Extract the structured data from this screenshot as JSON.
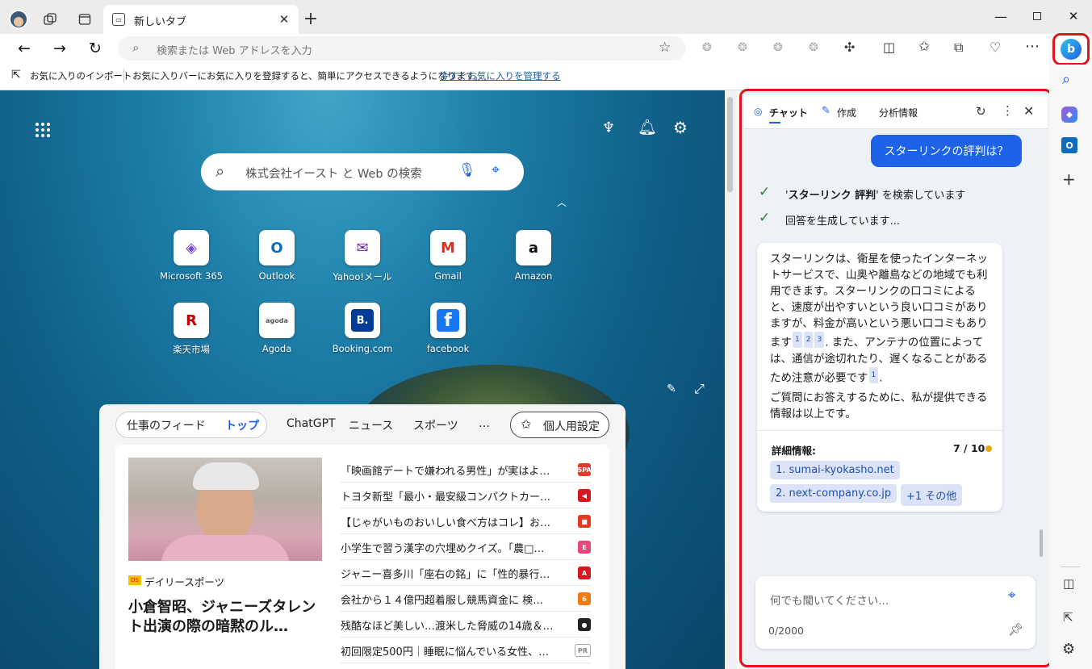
{
  "tab": {
    "title": "新しいタブ"
  },
  "address": {
    "placeholder": "検索または Web アドレスを入力"
  },
  "favbar": {
    "import_label": "お気に入りのインポート",
    "message": "お気に入りバーにお気に入りを登録すると、簡単にアクセスできるようになります。",
    "manage_link": "今すぐお気に入りを管理する"
  },
  "page": {
    "search_placeholder": "株式会社イースト と Web の検索",
    "tiles": [
      {
        "label": "Microsoft 365",
        "icon": "microsoft365-icon"
      },
      {
        "label": "Outlook",
        "icon": "outlook-icon"
      },
      {
        "label": "Yahoo!メール",
        "icon": "yahoo-mail-icon"
      },
      {
        "label": "Gmail",
        "icon": "gmail-icon"
      },
      {
        "label": "Amazon",
        "icon": "amazon-icon"
      },
      {
        "label": "楽天市場",
        "icon": "rakuten-icon"
      },
      {
        "label": "Agoda",
        "icon": "agoda-icon"
      },
      {
        "label": "Booking.com",
        "icon": "booking-icon"
      },
      {
        "label": "facebook",
        "icon": "facebook-icon"
      }
    ]
  },
  "feed": {
    "tabs": [
      "仕事のフィード",
      "トップ",
      "ChatGPT",
      "ニュース",
      "スポーツ",
      "…"
    ],
    "personalize": "個人用設定",
    "hero_source": "デイリースポーツ",
    "hero_title": "小倉智昭、ジャニーズタレント出演の際の暗黙のル…",
    "items": [
      {
        "text": "「映画館デートで嫌われる男性」が実はよ…",
        "src": "SPA",
        "color": "#e23b2c"
      },
      {
        "text": "トヨタ新型「最小・最安級コンパクトカー…",
        "src": "◀",
        "color": "#d7191f"
      },
      {
        "text": "【じゃがいものおいしい食べ方はコレ】お…",
        "src": "■",
        "color": "#e63a1e"
      },
      {
        "text": "小学生で習う漢字の穴埋めクイズ。「農□…",
        "src": "E",
        "color": "#e9477a"
      },
      {
        "text": "ジャニー喜多川「座右の銘」に「性的暴行…",
        "src": "A",
        "color": "#d71920"
      },
      {
        "text": "会社から１４億円超着服し競馬資金に 検…",
        "src": "6",
        "color": "#f07b12"
      },
      {
        "text": "残酷なほど美しい…渡米した脅威の14歳＆…",
        "src": "●",
        "color": "#222222"
      },
      {
        "text": "初回限定500円｜睡眠に悩んでいる女性、…",
        "src": "PR",
        "color": "#9a9a9a"
      }
    ]
  },
  "chat": {
    "tabs": [
      "チャット",
      "作成",
      "分析情報"
    ],
    "user_message": "スターリンクの評判は？",
    "status1_pre": "'",
    "status1_bold": "スターリンク 評判",
    "status1_post": "' を検索しています",
    "status2": "回答を生成しています...",
    "answer_part1": "スターリンクは、衛星を使ったインターネットサービスで、山奥や離島などの地域でも利用できます。スターリンクの口コミによると、速度が出やすいという良い口コミがありますが、料金が高いという悪い口コミもあります",
    "refs_a": [
      "1",
      "2",
      "3"
    ],
    "answer_part2": ". また、アンテナの位置によっては、通信が途切れたり、遅くなることがあるため注意が必要です",
    "refs_b": [
      "1"
    ],
    "answer_part3": ".",
    "answer_closing": "ご質問にお答えするために、私が提供できる情報は以上です。",
    "details_label": "詳細情報:",
    "count": "7 / 10",
    "links": [
      "1. sumai-kyokasho.net",
      "2. next-company.co.jp",
      "+1 その他"
    ],
    "input_placeholder": "何でも聞いてください...",
    "char_count": "0/2000"
  },
  "colors": {
    "accent": "#1e62e8",
    "highlight": "#e0151b"
  }
}
